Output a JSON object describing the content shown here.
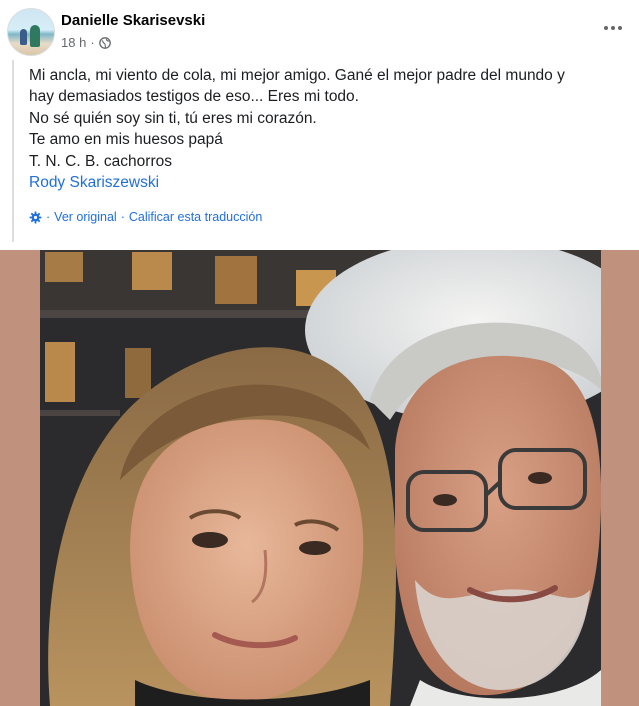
{
  "post": {
    "author": "Danielle Skarisevski",
    "time": "18 h",
    "separator": "·",
    "privacy_icon": "globe-icon",
    "more_icon": "more-dots-icon"
  },
  "body": {
    "lines": [
      "Mi ancla, mi viento de cola, mi mejor amigo. Gané el mejor padre del mundo y",
      "hay demasiados testigos de eso... Eres mi todo.",
      "No sé quién soy sin ti, tú eres mi corazón.",
      "Te amo en mis huesos papá",
      "T. N. C. B. cachorros"
    ],
    "tag": "Rody Skariszewski"
  },
  "translation": {
    "icon": "gear-icon",
    "sep1": "·",
    "see_original": "Ver original",
    "sep2": "·",
    "rate": "Calificar esta traducción"
  },
  "colors": {
    "link": "#216fdb",
    "photo_border": "#c0917d",
    "meta": "#65676b"
  }
}
